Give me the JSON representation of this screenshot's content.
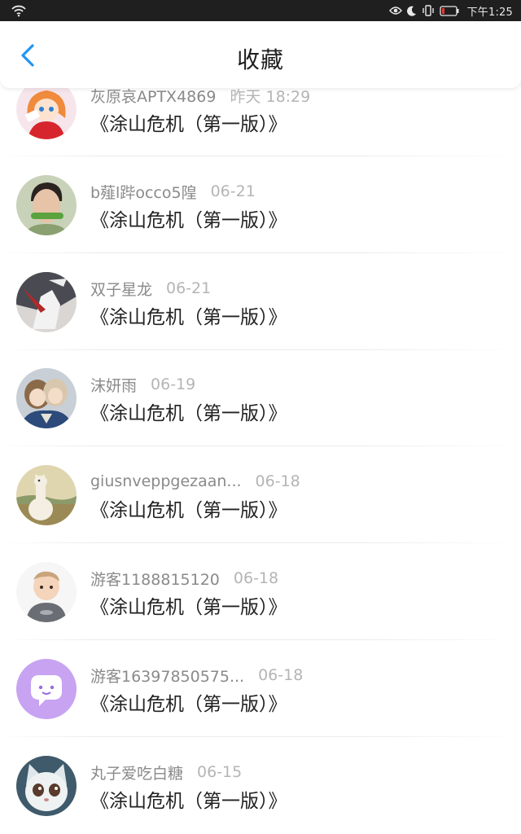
{
  "status_bar": {
    "time": "下午1:25",
    "icons": [
      "wifi-icon",
      "eye-icon",
      "moon-icon",
      "vibrate-icon",
      "battery-low-icon"
    ],
    "battery_color": "#e53935"
  },
  "header": {
    "title": "收藏",
    "back_icon": "chevron-left-icon",
    "accent_color": "#2196f3"
  },
  "favorites": [
    {
      "user": "灰原哀APTX4869",
      "date": "昨天 18:29",
      "title": "《涂山危机（第一版）》",
      "avatar": "anime-girl-avatar"
    },
    {
      "user": "b薤l跸occo5隍",
      "date": "06-21",
      "title": "《涂山危机（第一版）》",
      "avatar": "man-portrait-avatar"
    },
    {
      "user": "双子星龙",
      "date": "06-21",
      "title": "《涂山危机（第一版）》",
      "avatar": "knight-illustration-avatar"
    },
    {
      "user": "沫妍雨",
      "date": "06-19",
      "title": "《涂山危机（第一版）》",
      "avatar": "anime-couple-avatar"
    },
    {
      "user": "giusnveppgezaan...",
      "date": "06-18",
      "title": "《涂山危机（第一版）》",
      "avatar": "alpaca-avatar"
    },
    {
      "user": "游客1188815120",
      "date": "06-18",
      "title": "《涂山危机（第一版）》",
      "avatar": "baby-avatar"
    },
    {
      "user": "游客16397850575...",
      "date": "06-18",
      "title": "《涂山危机（第一版）》",
      "avatar": "chat-bubble-avatar"
    },
    {
      "user": "丸子爱吃白糖",
      "date": "06-15",
      "title": "《涂山危机（第一版）》",
      "avatar": "cartoon-cat-avatar"
    }
  ]
}
